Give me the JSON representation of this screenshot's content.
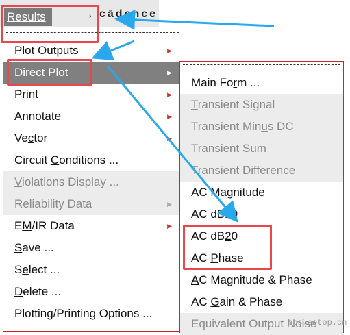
{
  "menubar": {
    "results_label": "Results",
    "brand": "cādence"
  },
  "main_menu": {
    "items": [
      {
        "pre": "Plot ",
        "u": "O",
        "post": "utputs",
        "submenu": true,
        "enabled": true
      },
      {
        "pre": "Direct ",
        "u": "P",
        "post": "lot",
        "submenu": true,
        "enabled": true,
        "highlighted": true
      },
      {
        "pre": "P",
        "u": "r",
        "post": "int",
        "submenu": true,
        "enabled": true
      },
      {
        "pre": "",
        "u": "A",
        "post": "nnotate",
        "submenu": true,
        "enabled": true
      },
      {
        "pre": "Ve",
        "u": "c",
        "post": "tor",
        "submenu": true,
        "enabled": true
      },
      {
        "pre": "Circuit ",
        "u": "C",
        "post": "onditions ...",
        "submenu": false,
        "enabled": true
      },
      {
        "pre": "",
        "u": "V",
        "post": "iolations Display ...",
        "submenu": false,
        "enabled": false
      },
      {
        "pre": "Reliability Data",
        "u": "",
        "post": "",
        "submenu": true,
        "enabled": false
      },
      {
        "pre": "E",
        "u": "M",
        "post": "/IR Data",
        "submenu": true,
        "enabled": true
      },
      {
        "pre": "",
        "u": "S",
        "post": "ave ...",
        "submenu": false,
        "enabled": true
      },
      {
        "pre": "S",
        "u": "e",
        "post": "lect ...",
        "submenu": false,
        "enabled": true
      },
      {
        "pre": "",
        "u": "D",
        "post": "elete ...",
        "submenu": false,
        "enabled": true
      },
      {
        "pre": "Plotting/Printing Options ...",
        "u": "",
        "post": "",
        "submenu": false,
        "enabled": true
      }
    ]
  },
  "direct_plot_menu": {
    "items": [
      {
        "pre": "Main Fo",
        "u": "r",
        "post": "m ...",
        "enabled": true
      },
      {
        "pre": "",
        "u": "T",
        "post": "ransient Signal",
        "enabled": false
      },
      {
        "pre": "Transient Min",
        "u": "u",
        "post": "s DC",
        "enabled": false
      },
      {
        "pre": "Transient ",
        "u": "S",
        "post": "um",
        "enabled": false
      },
      {
        "pre": "Transient Diff",
        "u": "e",
        "post": "rence",
        "enabled": false
      },
      {
        "pre": "AC ",
        "u": "M",
        "post": "agnitude",
        "enabled": true
      },
      {
        "pre": "AC dB",
        "u": "1",
        "post": "0",
        "enabled": true
      },
      {
        "pre": "AC dB",
        "u": "2",
        "post": "0",
        "enabled": true
      },
      {
        "pre": "AC ",
        "u": "P",
        "post": "hase",
        "enabled": true
      },
      {
        "pre": "",
        "u": "A",
        "post": "C Magnitude & Phase",
        "enabled": true
      },
      {
        "pre": "AC ",
        "u": "G",
        "post": "ain & Phase",
        "enabled": true
      },
      {
        "pre": "Equivalent Output Noise",
        "u": "",
        "post": "",
        "enabled": false
      }
    ]
  },
  "watermark": "bbs.eetop.cn",
  "colors": {
    "accent_red": "#e8474c",
    "arrow_blue": "#29a8ee",
    "highlight": "#808080"
  },
  "icons": {
    "submenu_arrow": "▶"
  }
}
